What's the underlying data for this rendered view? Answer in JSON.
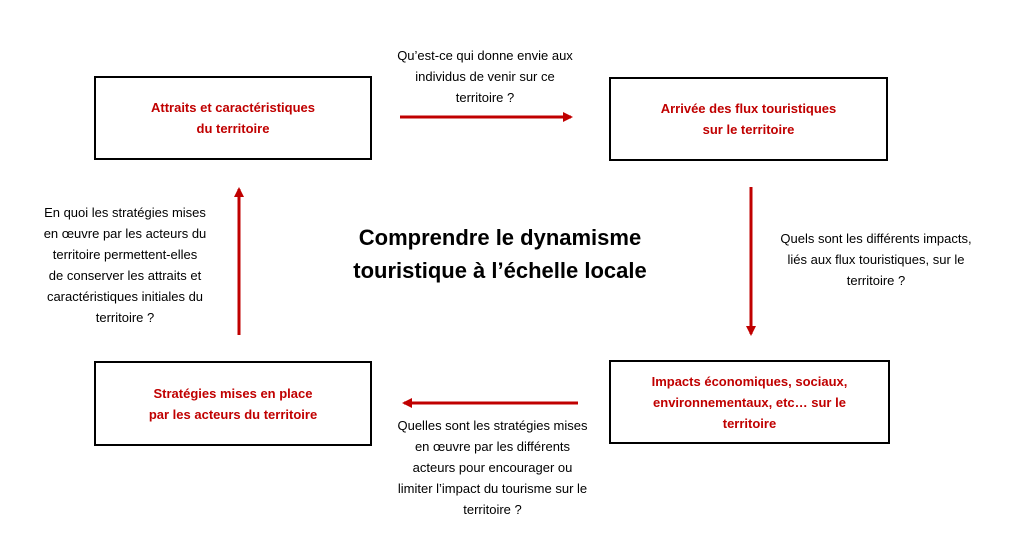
{
  "title": "Comprendre le dynamisme\ntouristique à l’échelle locale",
  "colors": {
    "accent": "#c00000",
    "border": "#000000",
    "text": "#000000"
  },
  "boxes": {
    "attraits": "Attraits et caractéristiques\ndu territoire",
    "arrivee": "Arrivée des flux touristiques\nsur le territoire",
    "impacts": "Impacts économiques, sociaux,\nenvironnementaux, etc… sur le\nterritoire",
    "strategies": "Stratégies mises en place\npar les acteurs du territoire"
  },
  "questions": {
    "top": "Qu’est-ce qui donne envie aux\nindividus de venir sur ce\nterritoire ?",
    "right": "Quels sont les différents impacts,\nliés aux flux touristiques, sur le\nterritoire ?",
    "bottom": "Quelles sont les stratégies mises\nen œuvre par les différents\nacteurs pour encourager ou\nlimiter l’impact du tourisme sur le\nterritoire ?",
    "left": "En quoi les stratégies mises\nen œuvre par les acteurs du\nterritoire permettent-elles\nde conserver les attraits et\ncaractéristiques initiales du\nterritoire ?"
  }
}
